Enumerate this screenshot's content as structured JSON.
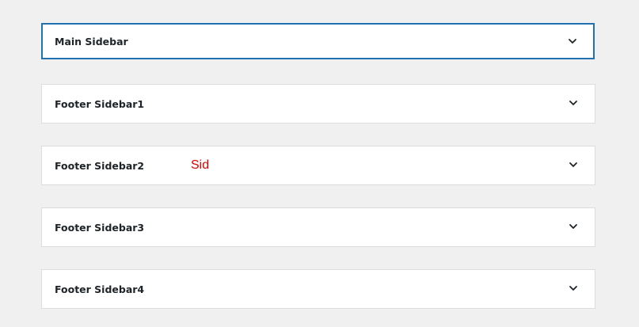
{
  "panels": [
    {
      "title": "Main Sidebar",
      "expanded": false,
      "focused": true
    },
    {
      "title": "Footer Sidebar1",
      "expanded": false,
      "focused": false
    },
    {
      "title": "Footer Sidebar2",
      "expanded": false,
      "focused": false,
      "annotation": "Sid"
    },
    {
      "title": "Footer Sidebar3",
      "expanded": false,
      "focused": false
    },
    {
      "title": "Footer Sidebar4",
      "expanded": false,
      "focused": false
    }
  ],
  "icons": {
    "toggle": "chevron-down-icon"
  },
  "colors": {
    "background": "#f0f0f1",
    "panel_bg": "#ffffff",
    "border": "#dcdcde",
    "focus_border": "#2271b1",
    "title_text": "#1d2327",
    "annotation_text": "#e00000"
  }
}
